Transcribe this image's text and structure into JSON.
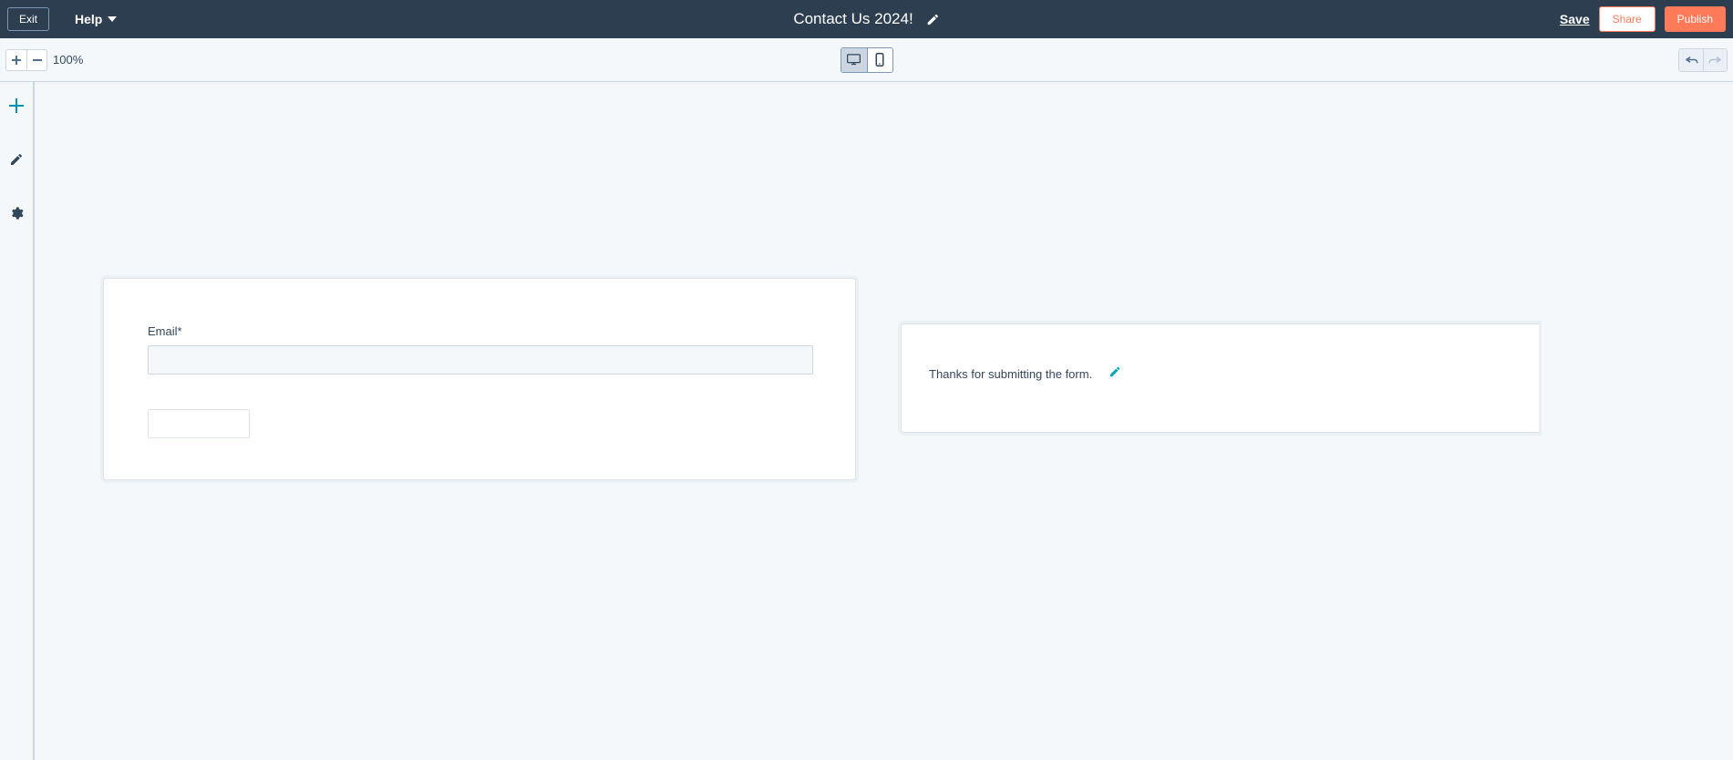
{
  "header": {
    "exit_label": "Exit",
    "help_label": "Help",
    "title": "Contact Us 2024!",
    "save_label": "Save",
    "share_label": "Share",
    "publish_label": "Publish"
  },
  "toolbar": {
    "zoom_level": "100%"
  },
  "form": {
    "email_label": "Email*",
    "email_value": ""
  },
  "confirmation": {
    "message": "Thanks for submitting the form."
  }
}
